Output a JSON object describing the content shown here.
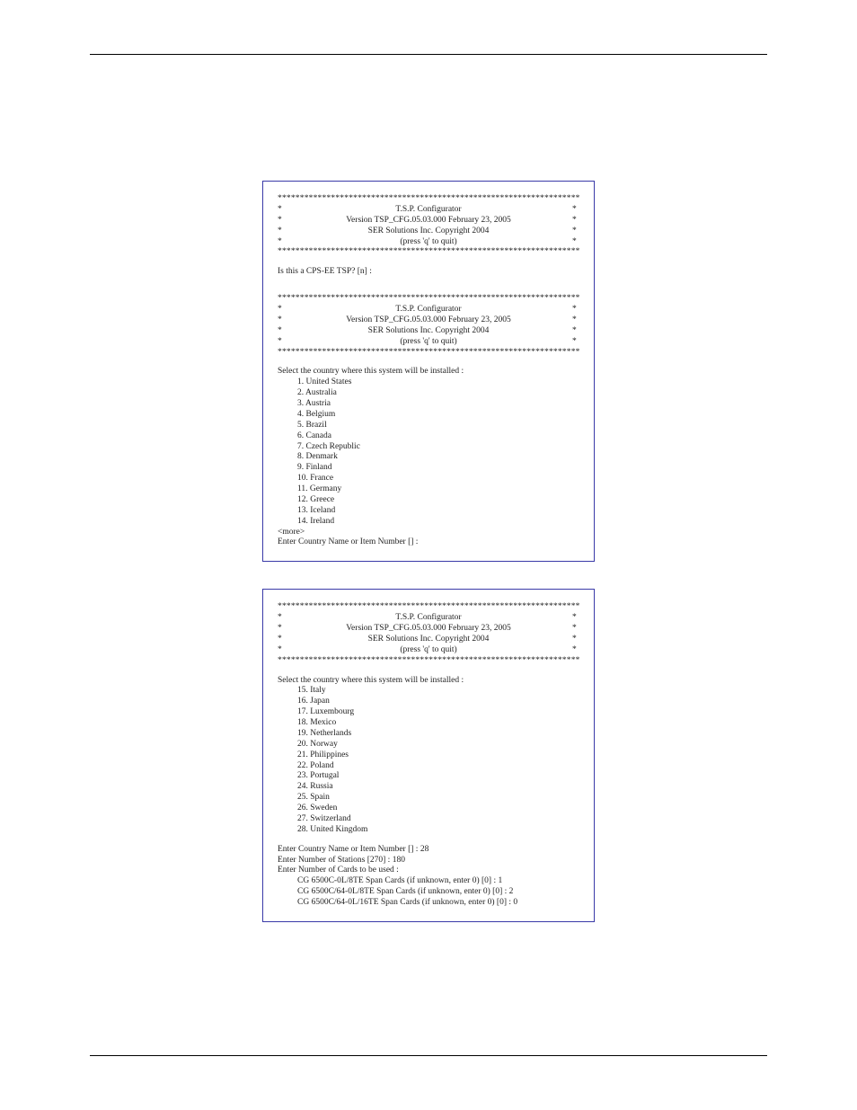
{
  "banner": {
    "starline": "**********************************************************************",
    "line1": "T.S.P. Configurator",
    "line2": "Version TSP_CFG.05.03.000    February 23, 2005",
    "line3": "SER Solutions Inc. Copyright 2004",
    "line4": "(press 'q' to quit)"
  },
  "box1": {
    "prompt_cps": "Is this a CPS-EE TSP? [n] :",
    "select_title": "Select the country where this system will be installed :",
    "countries": [
      "1. United States",
      "2. Australia",
      "3. Austria",
      "4. Belgium",
      "5. Brazil",
      "6. Canada",
      "7. Czech Republic",
      "8. Denmark",
      "9. Finland",
      "10. France",
      "11. Germany",
      "12. Greece",
      "13. Iceland",
      "14. Ireland"
    ],
    "more": "<more>",
    "enter_country": "Enter Country Name or Item Number [] :"
  },
  "box2": {
    "select_title": "Select the country where this system will be installed :",
    "countries": [
      "15. Italy",
      "16. Japan",
      "17. Luxembourg",
      "18. Mexico",
      "19. Netherlands",
      "20. Norway",
      "21. Philippines",
      "22. Poland",
      "23. Portugal",
      "24. Russia",
      "25. Spain",
      "26. Sweden",
      "27. Switzerland",
      "28. United Kingdom"
    ],
    "enter_country": "Enter Country Name or Item Number [] :  28",
    "enter_stations": "Enter Number of Stations [270] :  180",
    "enter_cards_hdr": "Enter Number of Cards to be used :",
    "cards": [
      "CG 6500C-0L/8TE Span Cards (if unknown, enter 0) [0] :  1",
      "CG 6500C/64-0L/8TE Span Cards (if unknown, enter 0) [0] :  2",
      "CG 6500C/64-0L/16TE Span Cards (if unknown, enter 0) [0] :  0"
    ]
  }
}
